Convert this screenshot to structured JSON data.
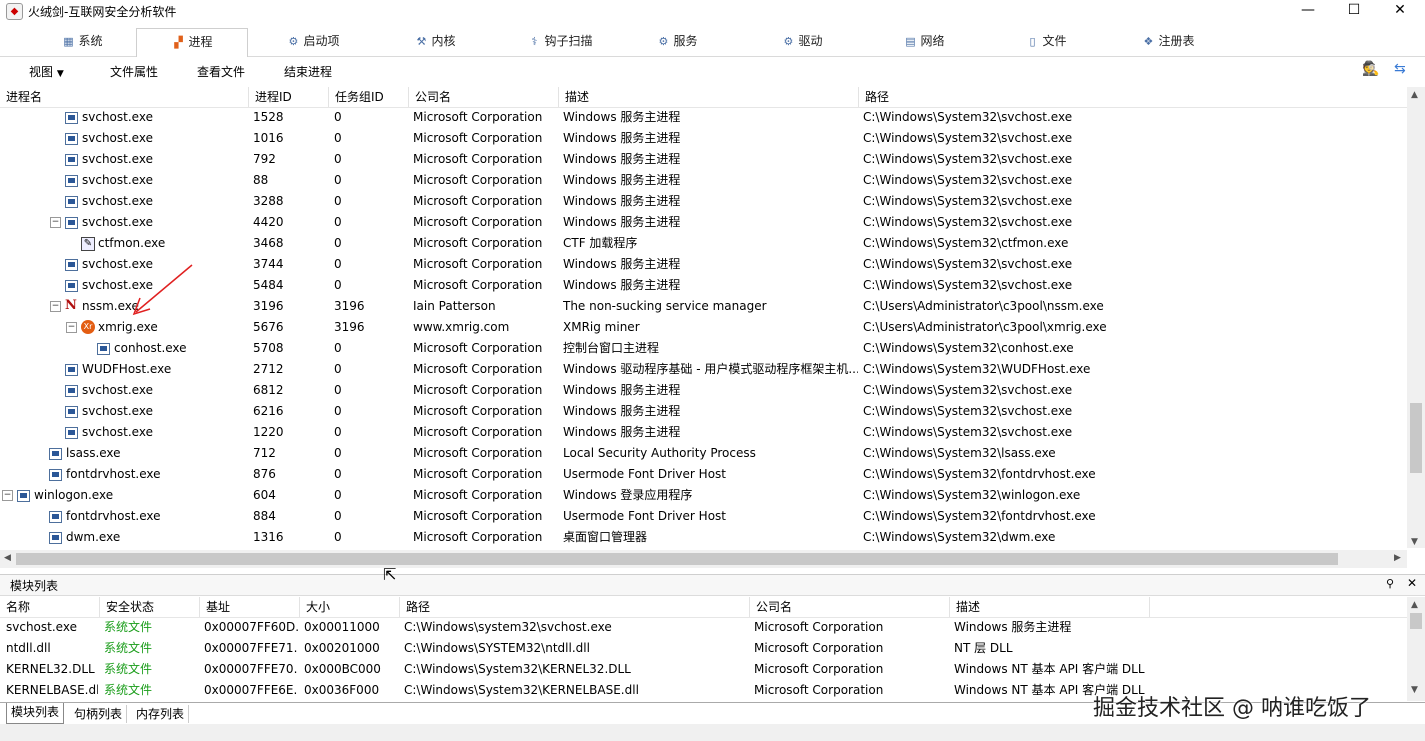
{
  "window": {
    "title": "火绒剑-互联网安全分析软件",
    "minimize": "—",
    "maximize": "☐",
    "close": "✕"
  },
  "tabs": [
    {
      "label": "系统",
      "icon": "system-icon"
    },
    {
      "label": "进程",
      "icon": "process-icon"
    },
    {
      "label": "启动项",
      "icon": "startup-icon"
    },
    {
      "label": "内核",
      "icon": "kernel-icon"
    },
    {
      "label": "钩子扫描",
      "icon": "hook-icon"
    },
    {
      "label": "服务",
      "icon": "service-icon"
    },
    {
      "label": "驱动",
      "icon": "driver-icon"
    },
    {
      "label": "网络",
      "icon": "network-icon"
    },
    {
      "label": "文件",
      "icon": "file-icon"
    },
    {
      "label": "注册表",
      "icon": "registry-icon"
    }
  ],
  "toolbar": {
    "view": "视图",
    "file_props": "文件属性",
    "view_file": "查看文件",
    "end_process": "结束进程"
  },
  "process_columns": [
    "进程名",
    "进程ID",
    "任务组ID",
    "公司名",
    "描述",
    "路径"
  ],
  "processes": [
    {
      "indent": 3,
      "toggle": "",
      "icon": "win",
      "name": "svchost.exe",
      "pid": "1528",
      "tgid": "0",
      "company": "Microsoft Corporation",
      "desc": "Windows 服务主进程",
      "path": "C:\\Windows\\System32\\svchost.exe"
    },
    {
      "indent": 3,
      "toggle": "",
      "icon": "win",
      "name": "svchost.exe",
      "pid": "1016",
      "tgid": "0",
      "company": "Microsoft Corporation",
      "desc": "Windows 服务主进程",
      "path": "C:\\Windows\\System32\\svchost.exe"
    },
    {
      "indent": 3,
      "toggle": "",
      "icon": "win",
      "name": "svchost.exe",
      "pid": "792",
      "tgid": "0",
      "company": "Microsoft Corporation",
      "desc": "Windows 服务主进程",
      "path": "C:\\Windows\\System32\\svchost.exe"
    },
    {
      "indent": 3,
      "toggle": "",
      "icon": "win",
      "name": "svchost.exe",
      "pid": "88",
      "tgid": "0",
      "company": "Microsoft Corporation",
      "desc": "Windows 服务主进程",
      "path": "C:\\Windows\\System32\\svchost.exe"
    },
    {
      "indent": 3,
      "toggle": "",
      "icon": "win",
      "name": "svchost.exe",
      "pid": "3288",
      "tgid": "0",
      "company": "Microsoft Corporation",
      "desc": "Windows 服务主进程",
      "path": "C:\\Windows\\System32\\svchost.exe"
    },
    {
      "indent": 3,
      "toggle": "⊟",
      "icon": "win",
      "name": "svchost.exe",
      "pid": "4420",
      "tgid": "0",
      "company": "Microsoft Corporation",
      "desc": "Windows 服务主进程",
      "path": "C:\\Windows\\System32\\svchost.exe"
    },
    {
      "indent": 4,
      "toggle": "",
      "icon": "edit",
      "name": "ctfmon.exe",
      "pid": "3468",
      "tgid": "0",
      "company": "Microsoft Corporation",
      "desc": "CTF 加载程序",
      "path": "C:\\Windows\\System32\\ctfmon.exe"
    },
    {
      "indent": 3,
      "toggle": "",
      "icon": "win",
      "name": "svchost.exe",
      "pid": "3744",
      "tgid": "0",
      "company": "Microsoft Corporation",
      "desc": "Windows 服务主进程",
      "path": "C:\\Windows\\System32\\svchost.exe"
    },
    {
      "indent": 3,
      "toggle": "",
      "icon": "win",
      "name": "svchost.exe",
      "pid": "5484",
      "tgid": "0",
      "company": "Microsoft Corporation",
      "desc": "Windows 服务主进程",
      "path": "C:\\Windows\\System32\\svchost.exe"
    },
    {
      "indent": 3,
      "toggle": "⊟",
      "icon": "n",
      "name": "nssm.exe",
      "pid": "3196",
      "tgid": "3196",
      "company": "Iain Patterson",
      "desc": "The non-sucking service manager",
      "path": "C:\\Users\\Administrator\\c3pool\\nssm.exe"
    },
    {
      "indent": 4,
      "toggle": "⊟",
      "icon": "x",
      "name": "xmrig.exe",
      "pid": "5676",
      "tgid": "3196",
      "company": "www.xmrig.com",
      "desc": "XMRig miner",
      "path": "C:\\Users\\Administrator\\c3pool\\xmrig.exe"
    },
    {
      "indent": 5,
      "toggle": "",
      "icon": "win",
      "name": "conhost.exe",
      "pid": "5708",
      "tgid": "0",
      "company": "Microsoft Corporation",
      "desc": "控制台窗口主进程",
      "path": "C:\\Windows\\System32\\conhost.exe"
    },
    {
      "indent": 3,
      "toggle": "",
      "icon": "win",
      "name": "WUDFHost.exe",
      "pid": "2712",
      "tgid": "0",
      "company": "Microsoft Corporation",
      "desc": "Windows 驱动程序基础 - 用户模式驱动程序框架主机...",
      "path": "C:\\Windows\\System32\\WUDFHost.exe"
    },
    {
      "indent": 3,
      "toggle": "",
      "icon": "win",
      "name": "svchost.exe",
      "pid": "6812",
      "tgid": "0",
      "company": "Microsoft Corporation",
      "desc": "Windows 服务主进程",
      "path": "C:\\Windows\\System32\\svchost.exe"
    },
    {
      "indent": 3,
      "toggle": "",
      "icon": "win",
      "name": "svchost.exe",
      "pid": "6216",
      "tgid": "0",
      "company": "Microsoft Corporation",
      "desc": "Windows 服务主进程",
      "path": "C:\\Windows\\System32\\svchost.exe"
    },
    {
      "indent": 3,
      "toggle": "",
      "icon": "win",
      "name": "svchost.exe",
      "pid": "1220",
      "tgid": "0",
      "company": "Microsoft Corporation",
      "desc": "Windows 服务主进程",
      "path": "C:\\Windows\\System32\\svchost.exe"
    },
    {
      "indent": 2,
      "toggle": "",
      "icon": "win",
      "name": "lsass.exe",
      "pid": "712",
      "tgid": "0",
      "company": "Microsoft Corporation",
      "desc": "Local Security Authority Process",
      "path": "C:\\Windows\\System32\\lsass.exe"
    },
    {
      "indent": 2,
      "toggle": "",
      "icon": "win",
      "name": "fontdrvhost.exe",
      "pid": "876",
      "tgid": "0",
      "company": "Microsoft Corporation",
      "desc": "Usermode Font Driver Host",
      "path": "C:\\Windows\\System32\\fontdrvhost.exe"
    },
    {
      "indent": 0,
      "toggle": "⊟",
      "icon": "win",
      "name": "winlogon.exe",
      "pid": "604",
      "tgid": "0",
      "company": "Microsoft Corporation",
      "desc": "Windows 登录应用程序",
      "path": "C:\\Windows\\System32\\winlogon.exe"
    },
    {
      "indent": 2,
      "toggle": "",
      "icon": "win",
      "name": "fontdrvhost.exe",
      "pid": "884",
      "tgid": "0",
      "company": "Microsoft Corporation",
      "desc": "Usermode Font Driver Host",
      "path": "C:\\Windows\\System32\\fontdrvhost.exe"
    },
    {
      "indent": 2,
      "toggle": "",
      "icon": "win",
      "name": "dwm.exe",
      "pid": "1316",
      "tgid": "0",
      "company": "Microsoft Corporation",
      "desc": "桌面窗口管理器",
      "path": "C:\\Windows\\System32\\dwm.exe"
    }
  ],
  "module_panel": {
    "title": "模块列表"
  },
  "module_columns": [
    "名称",
    "安全状态",
    "基址",
    "大小",
    "路径",
    "公司名",
    "描述"
  ],
  "modules": [
    {
      "name": "svchost.exe",
      "status": "系统文件",
      "base": "0x00007FF60D...",
      "size": "0x00011000",
      "path": "C:\\Windows\\system32\\svchost.exe",
      "company": "Microsoft Corporation",
      "desc": "Windows 服务主进程"
    },
    {
      "name": "ntdll.dll",
      "status": "系统文件",
      "base": "0x00007FFE71...",
      "size": "0x00201000",
      "path": "C:\\Windows\\SYSTEM32\\ntdll.dll",
      "company": "Microsoft Corporation",
      "desc": "NT 层 DLL"
    },
    {
      "name": "KERNEL32.DLL",
      "status": "系统文件",
      "base": "0x00007FFE70...",
      "size": "0x000BC000",
      "path": "C:\\Windows\\System32\\KERNEL32.DLL",
      "company": "Microsoft Corporation",
      "desc": "Windows NT 基本 API 客户端 DLL"
    },
    {
      "name": "KERNELBASE.dll",
      "status": "系统文件",
      "base": "0x00007FFE6E...",
      "size": "0x0036F000",
      "path": "C:\\Windows\\System32\\KERNELBASE.dll",
      "company": "Microsoft Corporation",
      "desc": "Windows NT 基本 API 客户端 DLL"
    }
  ],
  "bottom_tabs": [
    "模块列表",
    "句柄列表",
    "内存列表"
  ],
  "watermark": "掘金技术社区 @ 呐谁吃饭了",
  "colors": {
    "status_green": "#1a9d1a",
    "annotation_red": "#e02020"
  }
}
